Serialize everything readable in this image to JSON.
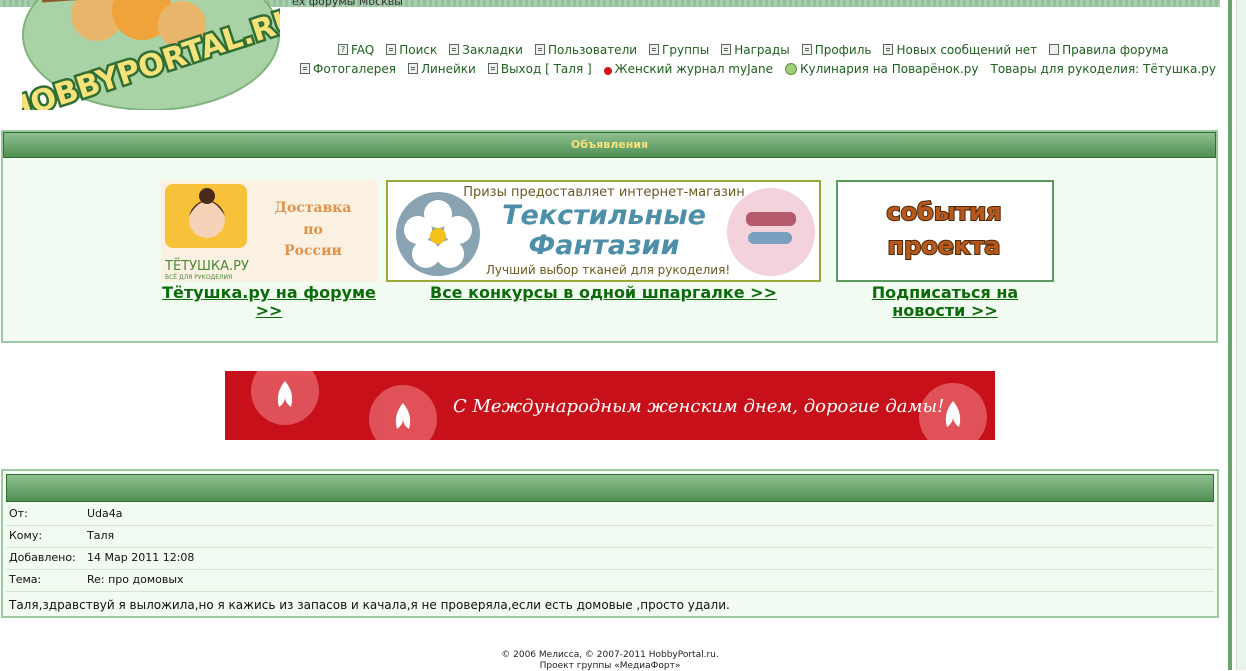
{
  "top_strip_text": "ех форумы Москвы",
  "logo": {
    "text": "HOBBYPORTAL.RU"
  },
  "nav": {
    "row1": [
      {
        "label": "FAQ",
        "icon": "help-icon"
      },
      {
        "label": "Поиск",
        "icon": "search-icon"
      },
      {
        "label": "Закладки",
        "icon": "bookmarks-icon"
      },
      {
        "label": "Пользователи",
        "icon": "users-icon"
      },
      {
        "label": "Группы",
        "icon": "groups-icon"
      },
      {
        "label": "Награды",
        "icon": "awards-icon"
      },
      {
        "label": "Профиль",
        "icon": "profile-icon"
      },
      {
        "label": "Новых сообщений нет",
        "icon": "messages-icon"
      },
      {
        "label": "Правила форума",
        "icon": "rules-icon"
      }
    ],
    "row2": [
      {
        "label": "Фотогалерея",
        "icon": "gallery-icon"
      },
      {
        "label": "Линейки",
        "icon": "rulers-icon"
      },
      {
        "label": "Выход [ Таля ]",
        "icon": "logout-icon"
      },
      {
        "label": "Женский журнал myJane",
        "icon": "cherry-icon"
      },
      {
        "label": "Кулинария на Поварёнок.ру",
        "icon": "chef-icon"
      },
      {
        "label": "Товары для рукоделия: Тётушка.ру",
        "icon": ""
      }
    ]
  },
  "announcements": {
    "title": "Объявления",
    "ad1": {
      "brand": "ТЁТУШКА.РУ",
      "tagline": "ВСЁ ДЛЯ РУКОДЕЛИЯ",
      "text1": "Доставка",
      "text2": "по",
      "text3": "России",
      "link": "Тётушка.ру на форуме >>"
    },
    "ad2": {
      "top": "Призы предоставляет интернет-магазин",
      "title1": "Текстильные",
      "title2": "Фантазии",
      "bottom": "Лучший выбор тканей для рукоделия!",
      "link": "Все конкурсы в одной шпаргалке >>"
    },
    "ad3": {
      "text1": "события",
      "text2": "проекта",
      "link": "Подписаться на новости >>"
    }
  },
  "banner": {
    "text": "С Международным женским днем, дорогие дамы!"
  },
  "message": {
    "from_label": "От:",
    "from": "Uda4a",
    "to_label": "Кому:",
    "to": "Таля",
    "date_label": "Добавлено:",
    "date": "14 Мар 2011 12:08",
    "subject_label": "Тема:",
    "subject": "Re: про домовых",
    "body": "Таля,здравствуй я выложила,но я кажись из запасов и качала,я не проверяла,если есть домовые ,просто удали."
  },
  "footer": {
    "line1": "© 2006 Мелисса, © 2007-2011 HobbyPortal.ru.",
    "line2": "Проект группы «МедиаФорт»"
  },
  "colors": {
    "header_green": "#4f8f53",
    "link_green": "#0b6b0b",
    "banner_red": "#c8101a",
    "panel_bg": "#f2fbf2"
  }
}
